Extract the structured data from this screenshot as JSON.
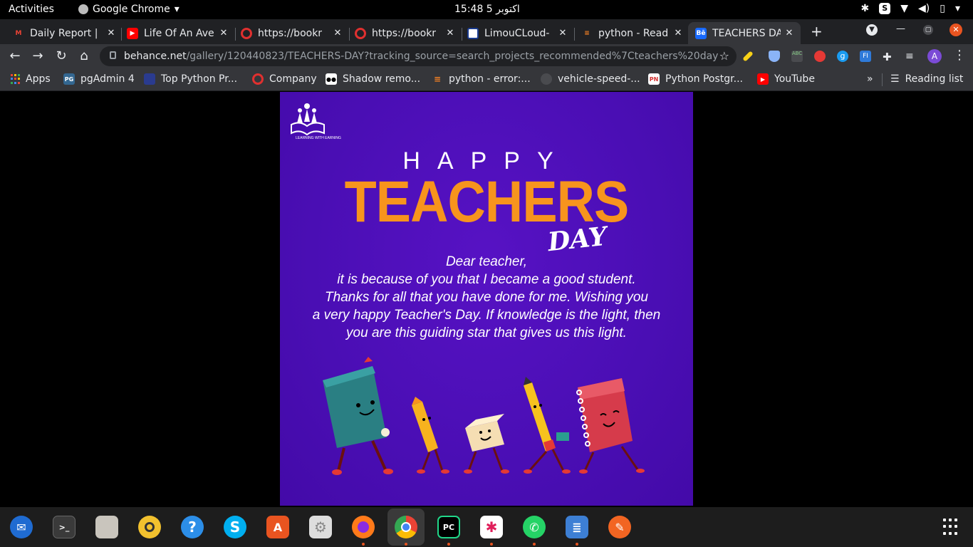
{
  "topbar": {
    "activities": "Activities",
    "app_name": "Google Chrome",
    "clock": "15:48  اکتوبر 5"
  },
  "tabs": [
    {
      "title": "Daily Report |",
      "favicon": "gmail-icon",
      "close": "✕"
    },
    {
      "title": "Life Of An Ave",
      "favicon": "youtube-icon",
      "close": "✕"
    },
    {
      "title": "https://bookr",
      "favicon": "opera-icon",
      "close": "✕"
    },
    {
      "title": "https://bookr",
      "favicon": "opera-icon",
      "close": "✕"
    },
    {
      "title": "LimouCLoud-",
      "favicon": "limou-icon",
      "close": "✕"
    },
    {
      "title": "python - Read",
      "favicon": "stackoverflow-icon",
      "close": "✕"
    },
    {
      "title": "TEACHERS DA",
      "favicon": "behance-icon",
      "close": "✕",
      "active": true
    }
  ],
  "address": {
    "host": "behance.net",
    "path": "/gallery/120440823/TEACHERS-DAY?tracking_source=search_projects_recommended%7Cteachers%20day"
  },
  "profile_initial": "A",
  "bookmarks": [
    {
      "label": "Apps",
      "icon": "apps-grid-icon"
    },
    {
      "label": "pgAdmin 4",
      "icon": "pgadmin-icon"
    },
    {
      "label": "Top Python Pr...",
      "icon": "python-icon"
    },
    {
      "label": "Company",
      "icon": "opera-icon"
    },
    {
      "label": "Shadow remo...",
      "icon": "medium-icon"
    },
    {
      "label": "python - error:...",
      "icon": "stackoverflow-icon"
    },
    {
      "label": "vehicle-speed-...",
      "icon": "github-icon"
    },
    {
      "label": "Python Postgr...",
      "icon": "pynative-icon"
    },
    {
      "label": "YouTube",
      "icon": "youtube-icon"
    }
  ],
  "bookmarks_overflow": "»",
  "reading_list": "Reading list",
  "poster": {
    "logo_text": "LEARNING WITH EARNING",
    "happy": "HAPPY",
    "teachers": "TEACHERS",
    "day": "DAY",
    "message_lines": [
      "Dear teacher,",
      "it is because of you that I became a good student.",
      "Thanks for all that you have done for me. Wishing you",
      "a very happy Teacher's Day. If knowledge is the light, then",
      "you are this guiding star that gives us this light."
    ],
    "colors": {
      "background": "#4b0fb8",
      "accent": "#f7941d"
    }
  },
  "dock": [
    {
      "name": "thunderbird-icon",
      "color": "#1f6bd1"
    },
    {
      "name": "terminal-icon",
      "color": "#3a3a3a",
      "glyph": ">_"
    },
    {
      "name": "files-icon",
      "color": "#c9c5bd"
    },
    {
      "name": "rhythmbox-icon",
      "color": "#f2c12e"
    },
    {
      "name": "help-icon",
      "color": "#2c8ee8",
      "glyph": "?"
    },
    {
      "name": "skype-icon",
      "color": "#00aff0",
      "glyph": "S"
    },
    {
      "name": "software-center-icon",
      "color": "#e95420",
      "glyph": "A"
    },
    {
      "name": "settings-icon",
      "color": "#ddd"
    },
    {
      "name": "firefox-icon",
      "color": "#ff7a1a"
    },
    {
      "name": "chrome-icon",
      "color": "#4285f4"
    },
    {
      "name": "pycharm-icon",
      "color": "#21d789",
      "glyph": "PC"
    },
    {
      "name": "slack-icon",
      "color": "#fff"
    },
    {
      "name": "whatsapp-icon",
      "color": "#25d366"
    },
    {
      "name": "text-editor-icon",
      "color": "#3d7fd4"
    },
    {
      "name": "pencil-app-icon",
      "color": "#f26522"
    }
  ]
}
